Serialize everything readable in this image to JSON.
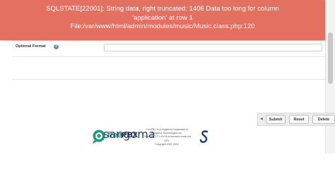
{
  "error": {
    "lines": [
      "SQLSTATE[22001]: String data, right truncated: 1406 Data too long for column",
      "'application' at row 1",
      "File:/var/www/html/admin/modules/music/Music.class.php:120"
    ]
  },
  "form": {
    "optional_format_label": "Optional Format",
    "optional_format_value": ""
  },
  "actions": {
    "submit": "Submit",
    "reset": "Reset",
    "delete": "Delete"
  },
  "footer": {
    "freepbx_free": "free",
    "freepbx_pbx": "PBX",
    "legal_lines": [
      "FreePBX is a registered trademark of",
      "Sangoma Technologies Inc.",
      "FreePBX 17.0.15.18 is licensed under the",
      "GPL",
      "Copyright 2007-2024"
    ],
    "sangoma": "sangoma"
  },
  "colors": {
    "error_bg": "#e47061",
    "freepbx_green": "#1a9a77",
    "sangoma_blue": "#1e3e6e"
  }
}
